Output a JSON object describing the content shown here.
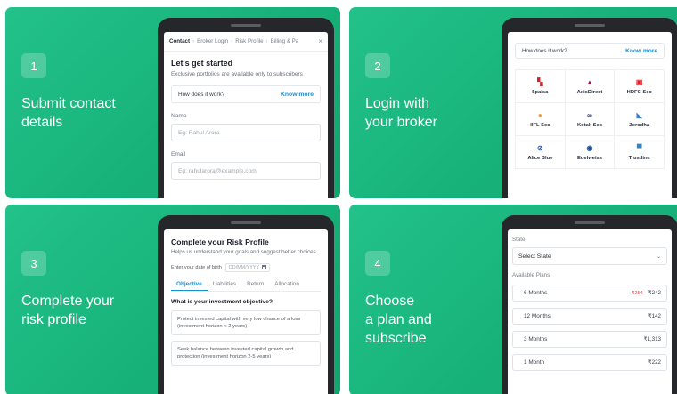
{
  "steps": [
    {
      "number": "1",
      "title": "Submit contact\ndetails"
    },
    {
      "number": "2",
      "title": "Login with\nyour broker"
    },
    {
      "number": "3",
      "title": "Complete your\nrisk profile"
    },
    {
      "number": "4",
      "title": "Choose\na plan and\nsubscribe"
    }
  ],
  "contact_screen": {
    "tabs": [
      "Contact",
      "Broker Login",
      "Risk Profile",
      "Billing & Pa"
    ],
    "close_glyph": "×",
    "title": "Let's get started",
    "subtitle": "Exclusive portfolios are available only to subscribers",
    "how_label": "How does it work?",
    "know_more": "Know more",
    "name_label": "Name",
    "name_placeholder": "Eg: Rahul Arora",
    "email_label": "Email",
    "email_placeholder": "Eg: rahularora@example.com"
  },
  "broker_screen": {
    "how_label": "How does it work?",
    "know_more": "Know more",
    "brokers": [
      {
        "name": "5paisa",
        "icon": "5paisa-logo-icon",
        "glyph": "▚",
        "color": "#d2232a"
      },
      {
        "name": "AxisDirect",
        "icon": "axisdirect-logo-icon",
        "glyph": "▲",
        "color": "#97144d"
      },
      {
        "name": "HDFC Sec",
        "icon": "hdfc-logo-icon",
        "glyph": "▣",
        "color": "#e31e24"
      },
      {
        "name": "IIFL Sec",
        "icon": "iifl-logo-icon",
        "glyph": "●",
        "color": "#f39c32"
      },
      {
        "name": "Kotak Sec",
        "icon": "kotak-logo-icon",
        "glyph": "∞",
        "color": "#1d2b5b"
      },
      {
        "name": "Zerodha",
        "icon": "zerodha-logo-icon",
        "glyph": "◣",
        "color": "#387ed1"
      },
      {
        "name": "Alice Blue",
        "icon": "aliceblue-logo-icon",
        "glyph": "⊘",
        "color": "#2c4f9e"
      },
      {
        "name": "Edelweiss",
        "icon": "edelweiss-logo-icon",
        "glyph": "◉",
        "color": "#1c4fa0"
      },
      {
        "name": "Trustline",
        "icon": "trustline-logo-icon",
        "glyph": "▀",
        "color": "#2f84c6"
      }
    ]
  },
  "risk_screen": {
    "title": "Complete your Risk Profile",
    "subtitle": "Helps us understand your goals and suggest better choices",
    "dob_label": "Enter your date of birth",
    "dob_placeholder": "DD/MM/YYYY",
    "tabs": [
      "Objective",
      "Liabilities",
      "Return",
      "Allocation"
    ],
    "question": "What is your investment objective?",
    "options": [
      "Protect invested capital with very low chance of a loss (investment horizon < 2 years)",
      "Seek balance between invested capital growth and protection (investment horizon 2-5 years)"
    ]
  },
  "plan_screen": {
    "state_label": "State",
    "state_value": "Select State",
    "plans_label": "Available Plans",
    "plans": [
      {
        "duration": "6 Months",
        "old_price": "₹254",
        "price": "₹242"
      },
      {
        "duration": "12 Months",
        "old_price": "",
        "price": "₹142"
      },
      {
        "duration": "3 Months",
        "old_price": "",
        "price": "₹1,313"
      },
      {
        "duration": "1 Month",
        "old_price": "",
        "price": "₹222"
      }
    ]
  },
  "colors": {
    "card_green": "#1bb981",
    "link_blue": "#1a8fd6",
    "strike_red": "#e04a4a"
  }
}
